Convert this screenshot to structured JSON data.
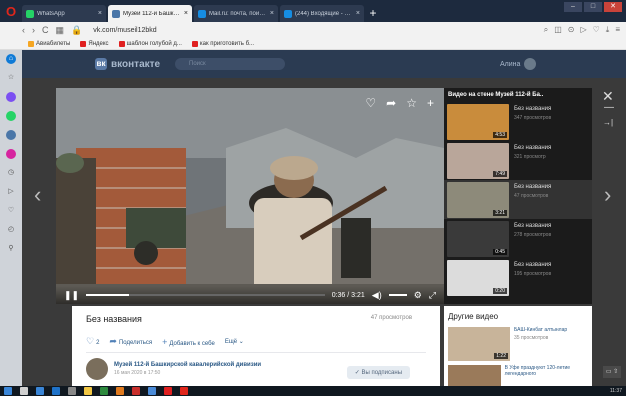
{
  "browser": {
    "tabs": [
      {
        "label": "WhatsApp",
        "color": "#25d366",
        "active": false
      },
      {
        "label": "Музей 112-й Башкирской",
        "color": "#4a76a8",
        "active": true
      },
      {
        "label": "Mail.ru: почта, поиск в инт",
        "color": "#168de2",
        "active": false
      },
      {
        "label": "(244) Входящие - Почта",
        "color": "#168de2",
        "active": false
      }
    ],
    "new_tab": "+",
    "url": "vk.com/museil12bkd",
    "bookmarks": [
      "Авиабилеты",
      "Яндекс",
      "шаблон голубой д...",
      "как приготовить б..."
    ]
  },
  "vk": {
    "logo_text": "вконтакте",
    "search_placeholder": "Поиск",
    "user_name": "Алина"
  },
  "player": {
    "time": "0:36 / 3:21",
    "progress": 0.18
  },
  "playlist": {
    "header": "Видео на стене Музей 112-й Ба..",
    "items": [
      {
        "title": "Без названия",
        "views": "347 просмотров",
        "duration": "4:53",
        "color": "#c98c3c"
      },
      {
        "title": "Без названия",
        "views": "321 просмотр",
        "duration": "7:49",
        "color": "#b9a69a"
      },
      {
        "title": "Без названия",
        "views": "47 просмотров",
        "duration": "3:21",
        "color": "#8d8a7a",
        "active": true
      },
      {
        "title": "Без названия",
        "views": "278 просмотров",
        "duration": "0:45",
        "color": "#3a3a3a"
      },
      {
        "title": "Без названия",
        "views": "195 просмотров",
        "duration": "0:20",
        "color": "#dcdcdc"
      }
    ]
  },
  "info": {
    "title": "Без названия",
    "views": "47 просмотров",
    "likes": "2",
    "share": "Поделиться",
    "add": "Добавить к себе",
    "more": "Ещё",
    "owner_name": "Музей 112-й Башкирской кавалерийской дивизии",
    "owner_date": "16 мая 2020 в 17:50",
    "subscribed": "Вы подписаны"
  },
  "other_videos": {
    "header": "Другие видео",
    "items": [
      {
        "title": "БАШ-Кинбат алтынлар",
        "views": "35 просмотров",
        "duration": "1:22"
      },
      {
        "title": "В Уфе празднуют 120-летие легендарного",
        "views": "",
        "duration": ""
      }
    ]
  },
  "taskbar": {
    "clock": "11:37"
  }
}
